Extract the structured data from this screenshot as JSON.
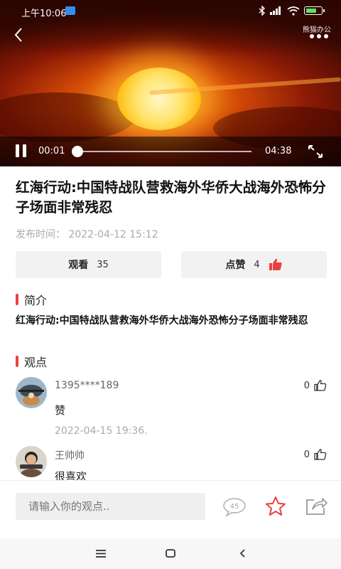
{
  "status_bar": {
    "time": "上午10:06"
  },
  "video": {
    "watermark": "熊猫办公",
    "current_time": "00:01",
    "total_time": "04:38",
    "progress_fraction": 0.004
  },
  "article": {
    "title": "红海行动:中国特战队营救海外华侨大战海外恐怖分子场面非常残忍",
    "publish_label": "发布时间：",
    "publish_time": "2022-04-12 15:12"
  },
  "stats": {
    "views_label": "观看",
    "views_count": "35",
    "likes_label": "点赞",
    "likes_count": "4",
    "accent_color": "#e8423f"
  },
  "intro": {
    "heading": "简介",
    "text": "红海行动:中国特战队营救海外华侨大战海外恐怖分子场面非常残忍"
  },
  "comments_section": {
    "heading": "观点",
    "items": [
      {
        "user": "1395****189",
        "likes": "0",
        "body": "赞",
        "date": "2022-04-15 19:36."
      },
      {
        "user": "王帅帅",
        "likes": "0",
        "body": "很喜欢",
        "date": ""
      }
    ]
  },
  "bottom_bar": {
    "input_placeholder": "请输入你的观点..",
    "comment_count": "45"
  }
}
